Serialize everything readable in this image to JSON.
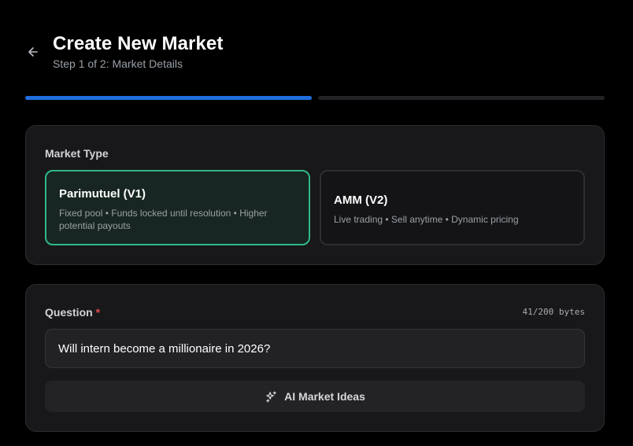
{
  "header": {
    "back_icon": "arrow-left-icon",
    "title": "Create New Market",
    "subtitle": "Step 1 of 2: Market Details"
  },
  "progress": {
    "current_step": 1,
    "total_steps": 2,
    "active_color": "#1f6fe0",
    "inactive_color": "#222325"
  },
  "market_type": {
    "label": "Market Type",
    "selected": "parimutuel",
    "options": [
      {
        "id": "parimutuel",
        "name": "Parimutuel (V1)",
        "description": "Fixed pool • Funds locked until resolution • Higher potential payouts",
        "selected": true,
        "accent_color": "#2fb888"
      },
      {
        "id": "amm",
        "name": "AMM (V2)",
        "description": "Live trading • Sell anytime • Dynamic pricing",
        "selected": false
      }
    ]
  },
  "question": {
    "label": "Question",
    "required_marker": "*",
    "byte_count": "41/200 bytes",
    "value": "Will intern become a millionaire in 2026?",
    "ai_button_label": "AI Market Ideas",
    "ai_button_icon": "sparkles-icon"
  }
}
